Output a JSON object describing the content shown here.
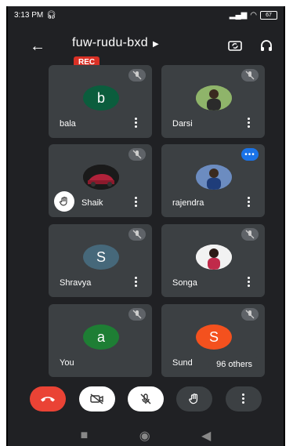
{
  "status": {
    "time": "3:13 PM",
    "battery": "67"
  },
  "meeting": {
    "code": "fuw-rudu-bxd",
    "rec_label": "REC"
  },
  "participants": [
    {
      "name": "bala",
      "initial": "b",
      "avatar_color": "#0b5d3d",
      "badge": "mic-off"
    },
    {
      "name": "Darsi",
      "initial": "",
      "avatar_color": "#7a9a5a",
      "badge": "mic-off"
    },
    {
      "name": "Shaik",
      "initial": "",
      "avatar_color": "#b0223a",
      "badge": "mic-off",
      "hand_raised": true
    },
    {
      "name": "rajendra",
      "initial": "",
      "avatar_color": "#4a6ea8",
      "badge": "speaking"
    },
    {
      "name": "Shravya",
      "initial": "S",
      "avatar_color": "#46687a",
      "badge": "mic-off"
    },
    {
      "name": "Songa",
      "initial": "",
      "avatar_color": "#c02a4a",
      "badge": "mic-off"
    },
    {
      "name": "You",
      "initial": "a",
      "avatar_color": "#1e7e34",
      "badge": "mic-off"
    },
    {
      "name": "Sund",
      "initial": "S",
      "avatar_color": "#f4511e",
      "badge": "mic-off"
    }
  ],
  "others_label": "96 others",
  "colors": {
    "bg": "#202124",
    "tile": "#3c4043",
    "end_call": "#ea4335"
  }
}
